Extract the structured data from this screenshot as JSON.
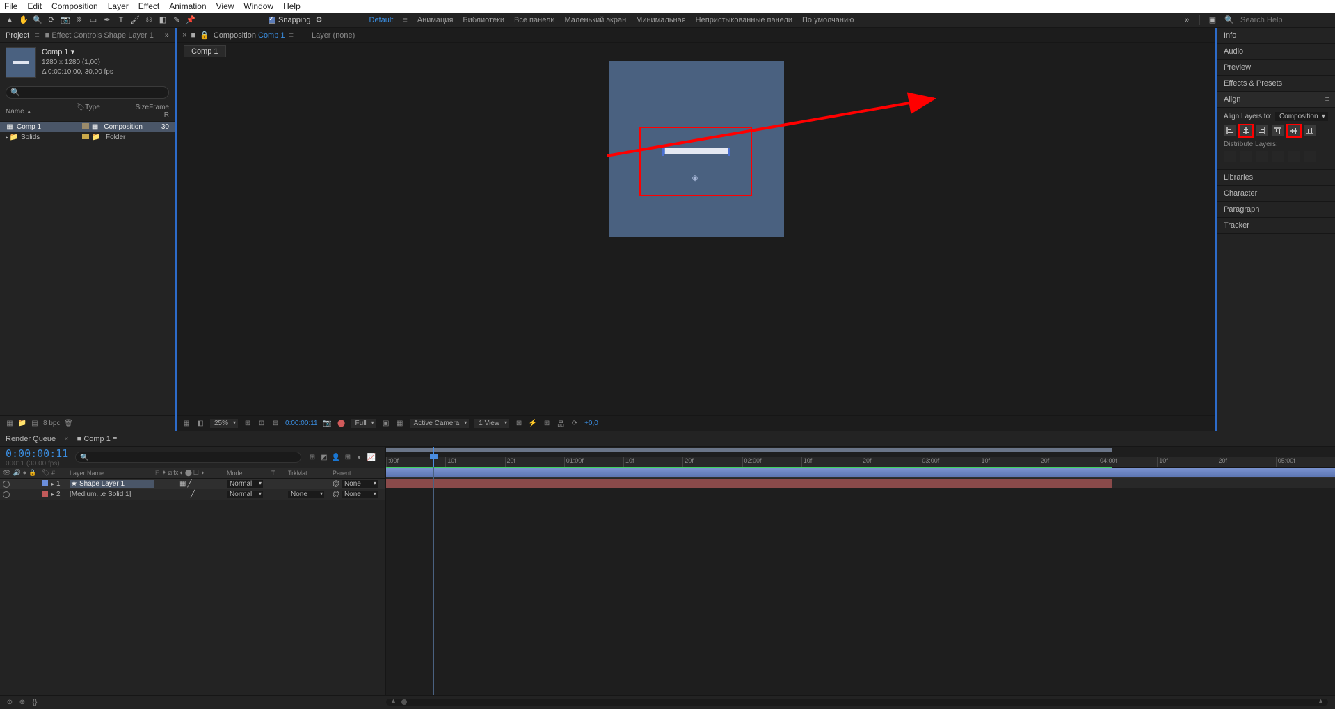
{
  "menubar": [
    "File",
    "Edit",
    "Composition",
    "Layer",
    "Effect",
    "Animation",
    "View",
    "Window",
    "Help"
  ],
  "toolbar": {
    "snapping_label": "Snapping",
    "workspace_tabs": [
      "Default",
      "Анимация",
      "Библиотеки",
      "Все панели",
      "Маленький экран",
      "Минимальная",
      "Непристыкованные панели",
      "По умолчанию"
    ],
    "search_placeholder": "Search Help"
  },
  "project_panel": {
    "tab1": "Project",
    "tab2": "Effect Controls Shape Layer 1",
    "comp_name": "Comp 1 ▾",
    "dims": "1280 x 1280 (1,00)",
    "dur": "Δ 0:00:10:00, 30,00 fps",
    "cols": {
      "name": "Name",
      "type": "Type",
      "size": "Size",
      "fr": "Frame R"
    },
    "items": [
      {
        "name": "Comp 1",
        "type": "Composition",
        "fr": "30",
        "icon": "comp",
        "sel": true
      },
      {
        "name": "Solids",
        "type": "Folder",
        "fr": "",
        "icon": "folder",
        "sel": false
      }
    ],
    "bpc": "8 bpc"
  },
  "comp_panel": {
    "crumb_prefix": "Composition",
    "crumb_link": "Comp 1",
    "layer_label": "Layer (none)",
    "tab": "Comp 1",
    "footer": {
      "mag": "25%",
      "time": "0:00:00:11",
      "res": "Full",
      "cam": "Active Camera",
      "views": "1 View",
      "expo": "+0,0"
    }
  },
  "right_panel": {
    "sections": [
      "Info",
      "Audio",
      "Preview",
      "Effects & Presets",
      "Align",
      "Libraries",
      "Character",
      "Paragraph",
      "Tracker"
    ],
    "align": {
      "layers_to_label": "Align Layers to:",
      "layers_to_value": "Composition",
      "distribute_label": "Distribute Layers:"
    }
  },
  "timeline": {
    "tabs": {
      "rq": "Render Queue",
      "comp": "Comp 1"
    },
    "time": "0:00:00:11",
    "sub": "00011 (30.00 fps)",
    "cols": {
      "idx": "#",
      "name": "Layer Name",
      "mode": "Mode",
      "t": "T",
      "trk": "TrkMat",
      "par": "Parent"
    },
    "rows": [
      {
        "idx": "1",
        "name": "Shape Layer 1",
        "mode": "Normal",
        "trk": "",
        "par": "None",
        "color": "#6b8edb",
        "sel": true,
        "star": true
      },
      {
        "idx": "2",
        "name": "[Medium...e Solid 1]",
        "mode": "Normal",
        "trk": "None",
        "par": "None",
        "color": "#c15a5a",
        "sel": false,
        "star": false
      }
    ],
    "ruler": [
      ":00f",
      "10f",
      "20f",
      "01:00f",
      "10f",
      "20f",
      "02:00f",
      "10f",
      "20f",
      "03:00f",
      "10f",
      "20f",
      "04:00f",
      "10f",
      "20f",
      "05:00f"
    ]
  }
}
